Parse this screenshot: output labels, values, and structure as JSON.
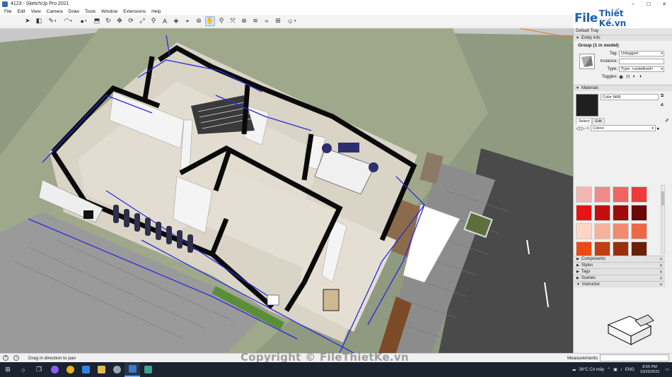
{
  "window": {
    "title": "4123 - SketchUp Pro 2021",
    "controls": [
      "–",
      "☐",
      "✕"
    ]
  },
  "menu": [
    "File",
    "Edit",
    "View",
    "Camera",
    "Draw",
    "Tools",
    "Window",
    "Extensions",
    "Help"
  ],
  "toolbar": {
    "tools": [
      {
        "icon": "select-arrow-icon",
        "glyph": "➤",
        "selected": false,
        "dropdown": false
      },
      {
        "icon": "eraser-icon",
        "glyph": "◧",
        "selected": false,
        "dropdown": false
      },
      {
        "icon": "pencil-line-icon",
        "glyph": "✎",
        "selected": false,
        "dropdown": true
      },
      {
        "icon": "arc-icon",
        "glyph": "◠",
        "selected": false,
        "dropdown": true
      },
      {
        "icon": "shape-icon",
        "glyph": "●",
        "selected": false,
        "dropdown": true
      },
      {
        "icon": "push-pull-icon",
        "glyph": "⬒",
        "selected": false,
        "dropdown": false
      },
      {
        "icon": "follow-me-icon",
        "glyph": "↻",
        "selected": false,
        "dropdown": false
      },
      {
        "icon": "move-icon",
        "glyph": "✥",
        "selected": false,
        "dropdown": false
      },
      {
        "icon": "rotate-icon",
        "glyph": "⟳",
        "selected": false,
        "dropdown": false
      },
      {
        "icon": "scale-icon",
        "glyph": "⤢",
        "selected": false,
        "dropdown": false
      },
      {
        "icon": "tape-measure-icon",
        "glyph": "⚲",
        "selected": false,
        "dropdown": false
      },
      {
        "icon": "text-icon",
        "glyph": "A",
        "selected": false,
        "dropdown": false
      },
      {
        "icon": "section-plane-icon",
        "glyph": "◈",
        "selected": false,
        "dropdown": false
      },
      {
        "icon": "paint-bucket-icon",
        "glyph": "◓",
        "selected": false,
        "dropdown": false
      },
      {
        "icon": "orbit-icon",
        "glyph": "⊛",
        "selected": false,
        "dropdown": false
      },
      {
        "icon": "pan-hand-icon",
        "glyph": "✋",
        "selected": true,
        "dropdown": false
      },
      {
        "icon": "zoom-icon",
        "glyph": "⚲",
        "selected": false,
        "dropdown": false
      },
      {
        "icon": "zoom-extents-icon",
        "glyph": "⤧",
        "selected": false,
        "dropdown": false
      },
      {
        "icon": "warehouse-icon",
        "glyph": "⊕",
        "selected": false,
        "dropdown": false
      },
      {
        "icon": "extension-warehouse-icon",
        "glyph": "≋",
        "selected": false,
        "dropdown": false
      },
      {
        "icon": "layout-send-icon",
        "glyph": "≈",
        "selected": false,
        "dropdown": false
      },
      {
        "icon": "ext-manager-icon",
        "glyph": "⊞",
        "selected": false,
        "dropdown": false
      },
      {
        "icon": "account-icon",
        "glyph": "☺",
        "selected": false,
        "dropdown": true
      }
    ]
  },
  "tray": {
    "title": "Default Tray",
    "entity_info": {
      "heading": "Entity Info",
      "selection": "Group (1 in model)",
      "tag_label": "Tag:",
      "tag_value": "Untagged",
      "instance_label": "Instance:",
      "instance_value": "",
      "type_label": "Type:",
      "type_value": "Type: <undefined>",
      "toggles_label": "Toggles:"
    },
    "materials": {
      "heading": "Materials",
      "current_name": "Color M08",
      "current_color": "#1f1f1f",
      "tabs": [
        "Select",
        "Edit"
      ],
      "library": "Colors",
      "swatches": [
        "#f5b5b5",
        "#ef8a8a",
        "#f06464",
        "#ee3a3a",
        "#e81414",
        "#c40e0e",
        "#9e0b0b",
        "#6a0808",
        "#fcd6c6",
        "#f7b29a",
        "#f28a6d",
        "#ed6745",
        "#eb4a12",
        "#c43d0d",
        "#9a2f09",
        "#6b2106",
        "#fde1c2",
        "#f9c99a",
        "#f5b06d",
        "#f29740"
      ]
    },
    "collapsed_panels": [
      "Components",
      "Styles",
      "Tags",
      "Scenes"
    ],
    "instructor": "Instructor"
  },
  "status": {
    "hint": "Drag in direction to pan",
    "measurements_label": "Measurements",
    "watermark": "Copyright © FileThietKe.vn"
  },
  "logo": {
    "file": "File",
    "rest": "Thiết Kế.vn"
  },
  "taskbar": {
    "weather": "26°C  Có mây",
    "lang": "ENG",
    "time": "8:55 PM",
    "date": "10/23/2022"
  }
}
